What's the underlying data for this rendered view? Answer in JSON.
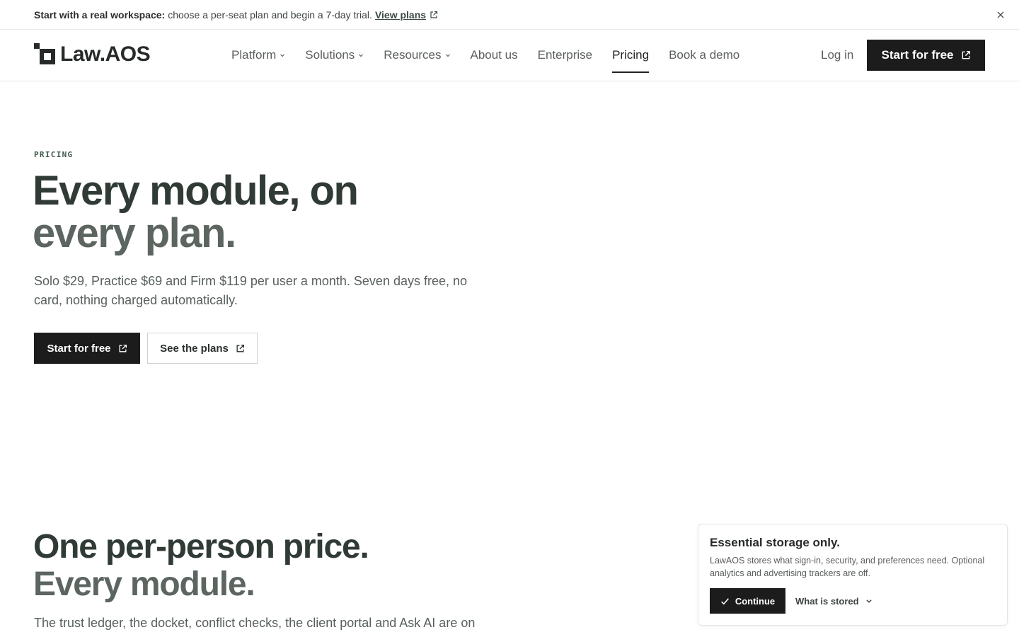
{
  "announcement": {
    "bold": "Start with a real workspace:",
    "text": "choose a per-seat plan and begin a 7-day trial.",
    "link": "View plans",
    "link_icon": "external-link-icon",
    "close_icon": "close-icon"
  },
  "header": {
    "logo_icon": "logo-mark-icon",
    "logo_text": "Law.AOS",
    "nav": [
      {
        "label": "Platform",
        "has_dropdown": true
      },
      {
        "label": "Solutions",
        "has_dropdown": true
      },
      {
        "label": "Resources",
        "has_dropdown": true
      },
      {
        "label": "About us",
        "has_dropdown": false
      },
      {
        "label": "Enterprise",
        "has_dropdown": false
      },
      {
        "label": "Pricing",
        "has_dropdown": false,
        "active": true
      },
      {
        "label": "Book a demo",
        "has_dropdown": false
      }
    ],
    "login": "Log in",
    "cta": "Start for free"
  },
  "hero": {
    "eyebrow": "PRICING",
    "title_line1": "Every module, on",
    "title_line2": "every plan.",
    "lead": "Solo $29, Practice $69 and Firm $119 per user a month. Seven days free, no card, nothing charged automatically.",
    "primary": "Start for free",
    "secondary": "See the plans"
  },
  "section2": {
    "title_line1": "One per-person price.",
    "title_line2": "Every module.",
    "text": "The trust ledger, the docket, conflict checks, the client portal and Ask AI are on"
  },
  "cookie": {
    "title": "Essential storage only.",
    "body": "LawAOS stores what sign-in, security, and preferences need. Optional analytics and advertising trackers are off.",
    "continue": "Continue",
    "more": "What is stored"
  },
  "colors": {
    "primary_button": "#1c1c1c",
    "heading": "#313b36",
    "heading_muted": "#5c6560",
    "eyebrow": "#3f5a4c"
  }
}
